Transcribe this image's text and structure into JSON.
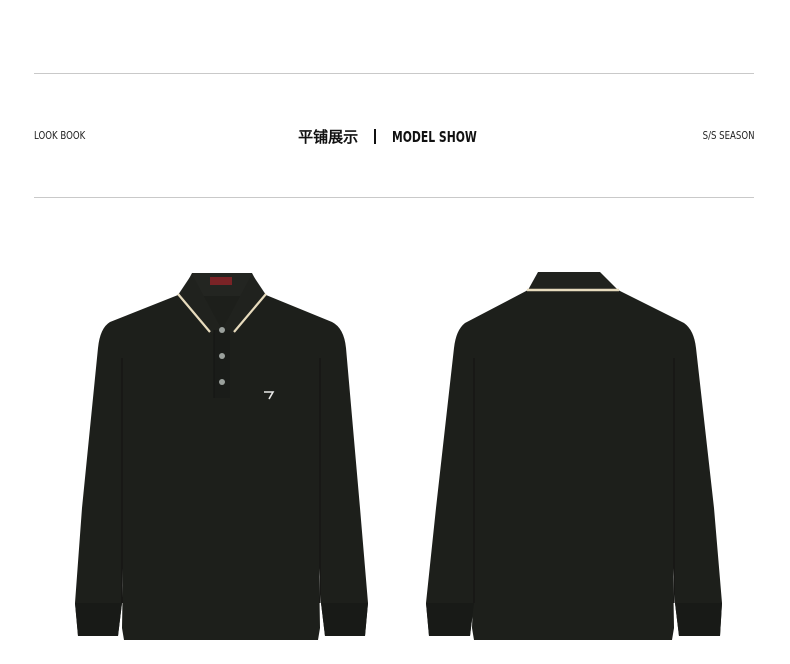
{
  "header": {
    "left_label": "LOOK BOOK",
    "title_cn": "平铺展示",
    "title_en": "MODEL SHOW",
    "right_label": "S/S SEASON"
  },
  "products": [
    {
      "view": "front",
      "icon": "polo-shirt-front-image"
    },
    {
      "view": "back",
      "icon": "polo-shirt-back-image"
    }
  ],
  "colors": {
    "shirt": "#1d1f1b",
    "collar_tipping": "#e7dbbd",
    "rule": "#c9c9c9",
    "text": "#111111"
  }
}
